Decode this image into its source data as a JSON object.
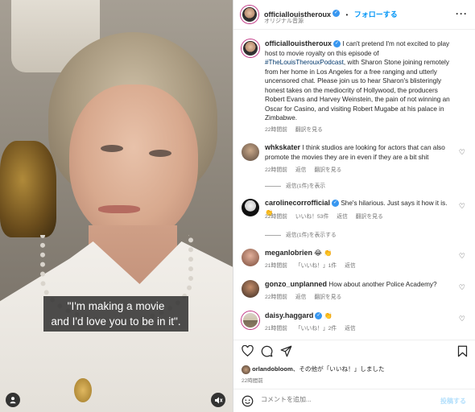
{
  "media": {
    "subtitle_line1": "\"I'm making a movie",
    "subtitle_line2": "and I'd love you to be in it\"."
  },
  "header": {
    "username": "officiallouistheroux",
    "separator": "•",
    "follow_label": "フォローする",
    "audio_label": "オリジナル音源",
    "more_icon": "more-icon"
  },
  "caption": {
    "username": "officiallouistheroux",
    "text_before": "I can't pretend I'm not excited to play host to movie royalty on this episode of ",
    "hashtag": "#TheLouisTherouxPodcast",
    "text_after": ", with Sharon Stone joining remotely from her home in Los Angeles for a free ranging and utterly uncensored chat. Please join us to hear Sharon's blisteringly honest takes on the mediocrity of Hollywood, the producers Robert Evans and Harvey Weinstein, the pain of not winning an Oscar for Casino, and visiting Robert Mugabe at his palace in Zimbabwe.",
    "time": "22時間前",
    "translate": "翻訳を見る"
  },
  "comments": [
    {
      "username": "whkskater",
      "text": "I think studios are looking for actors that can also promote the movies they are in even if they are a bit shit",
      "time": "22時間前",
      "likes": "",
      "reply": "返信",
      "translate": "翻訳を見る",
      "replies_label": "返信(1件)を表示"
    },
    {
      "username": "carolinecorrofficial",
      "text": "She's hilarious. Just says it how it is. 👏",
      "time": "22時間前",
      "likes": "いいね！53件",
      "reply": "返信",
      "translate": "翻訳を見る",
      "replies_label": "返信(1件)を表示する"
    },
    {
      "username": "meganlobrien",
      "text": "😂 👏",
      "time": "21時間前",
      "likes": "「いいね！」1件",
      "reply": "返信",
      "translate": ""
    },
    {
      "username": "gonzo_unplanned",
      "text": "How about another Police Academy?",
      "time": "22時間前",
      "likes": "",
      "reply": "返信",
      "translate": "翻訳を見る"
    },
    {
      "username": "daisy.haggard",
      "text": "👏",
      "time": "21時間前",
      "likes": "「いいね！」2件",
      "reply": "返信",
      "translate": ""
    }
  ],
  "actions": {
    "liked_by_user": "orlandobloom",
    "liked_by_rest": "、その他が「いいね！」しました",
    "time": "22時間前",
    "comment_placeholder": "コメントを追加...",
    "post_label": "投稿する"
  },
  "colors": {
    "link": "#00376b",
    "follow": "#0095f6",
    "verified": "#3897f0",
    "muted": "#737373"
  }
}
